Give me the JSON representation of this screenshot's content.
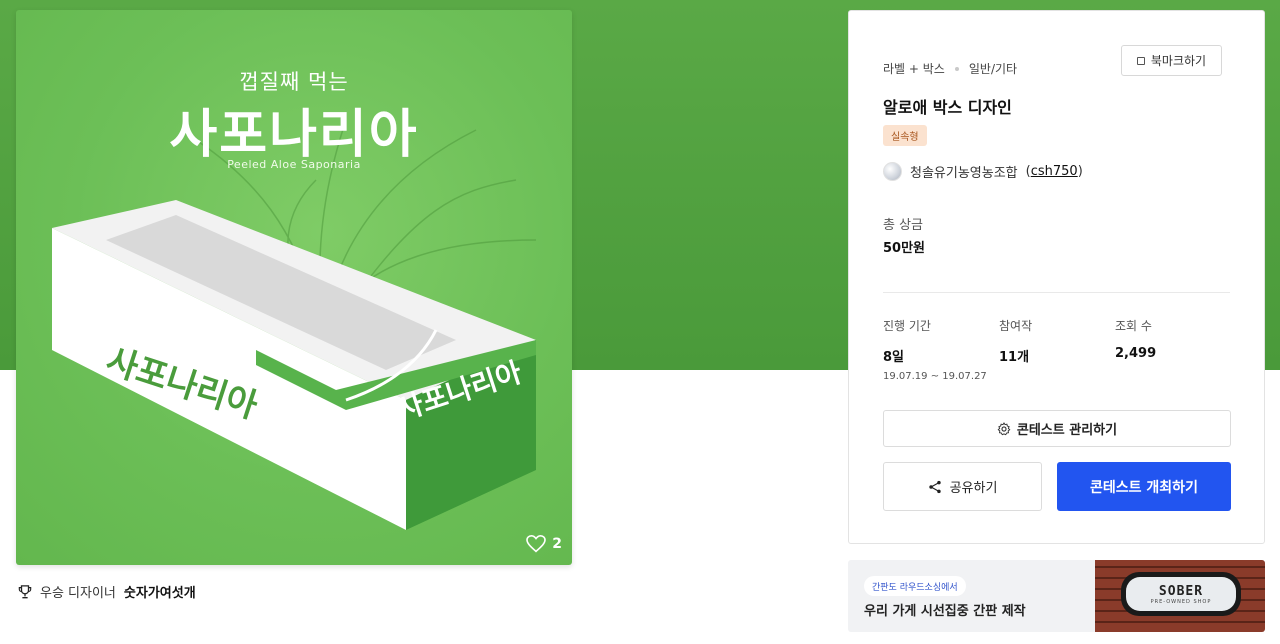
{
  "product_image": {
    "subtitle": "껍질째 먹는",
    "title": "사포나리아",
    "english": "Peeled Aloe Saponaria",
    "box_side_text": "사포나리아",
    "box_front_text": "사포나리아",
    "likes": "2",
    "background_color": "#6cbf57"
  },
  "winner": {
    "label": "우승 디자이너",
    "name": "숫자가여섯개"
  },
  "info": {
    "category": "라벨 + 박스",
    "subcategory": "일반/기타",
    "bookmark_label": "북마크하기",
    "title": "알로애 박스 디자인",
    "badge": "실속형",
    "host_name": "청솔유기농영농조합",
    "host_id": "csh750",
    "prize_label": "총 상금",
    "prize_value": "50만원",
    "stats": {
      "period_label": "진행 기간",
      "period_value": "8일",
      "period_range": "19.07.19 ~ 19.07.27",
      "entries_label": "참여작",
      "entries_value": "11개",
      "views_label": "조회 수",
      "views_value": "2,499"
    },
    "manage_label": "콘테스트 관리하기",
    "share_label": "공유하기",
    "host_contest_label": "콘테스트 개최하기"
  },
  "ad": {
    "tag": "간판도 라우드소싱에서",
    "text": "우리 가게 시선집중 간판 제작",
    "sign_brand": "SOBER",
    "sign_sub": "PRE-OWNED SHOP"
  },
  "colors": {
    "hero_green": "#5aa946",
    "primary_blue": "#2255f0",
    "badge_bg": "#fbe2cf"
  }
}
